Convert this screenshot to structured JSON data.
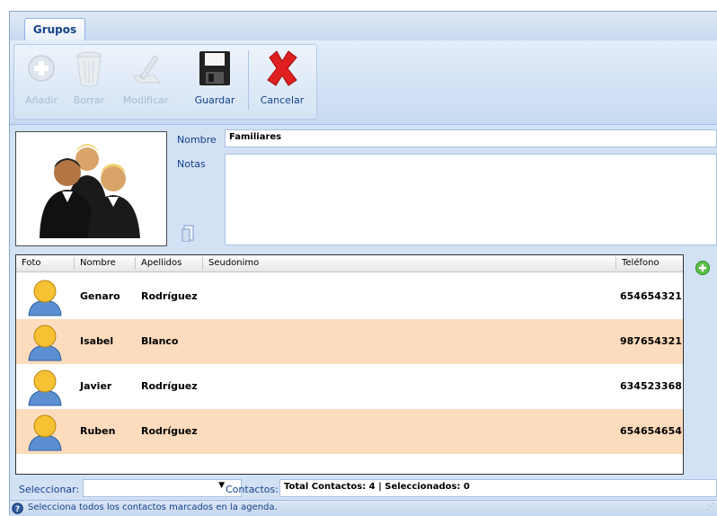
{
  "tab": {
    "label": "Grupos"
  },
  "ribbon": {
    "add_label": "Añadir",
    "delete_label": "Borrar",
    "modify_label": "Modificar",
    "save_label": "Guardar",
    "cancel_label": "Cancelar"
  },
  "form": {
    "name_label": "Nombre",
    "name_value": "Familiares",
    "notes_label": "Notas",
    "notes_value": ""
  },
  "table": {
    "headers": {
      "photo": "Foto",
      "name": "Nombre",
      "surname": "Apellidos",
      "alias": "Seudonimo",
      "phone": "Teléfono"
    },
    "rows": [
      {
        "name": "Genaro",
        "surname": "Rodríguez",
        "alias": "",
        "phone": "654654321"
      },
      {
        "name": "Isabel",
        "surname": "Blanco",
        "alias": "",
        "phone": "987654321"
      },
      {
        "name": "Javier",
        "surname": "Rodríguez",
        "alias": "",
        "phone": "634523368"
      },
      {
        "name": "Ruben",
        "surname": "Rodríguez",
        "alias": "",
        "phone": "654654654"
      }
    ]
  },
  "footer": {
    "select_label": "Seleccionar:",
    "select_value": "",
    "contacts_label": "Contactos:",
    "contacts_summary": "Total Contactos: 4 | Seleccionados: 0"
  },
  "status": {
    "text": "Selecciona todos los contactos marcados en la agenda."
  },
  "colors": {
    "accent": "#15428b",
    "row_alt": "#fddcbd",
    "panel": "#d2e1f4"
  }
}
